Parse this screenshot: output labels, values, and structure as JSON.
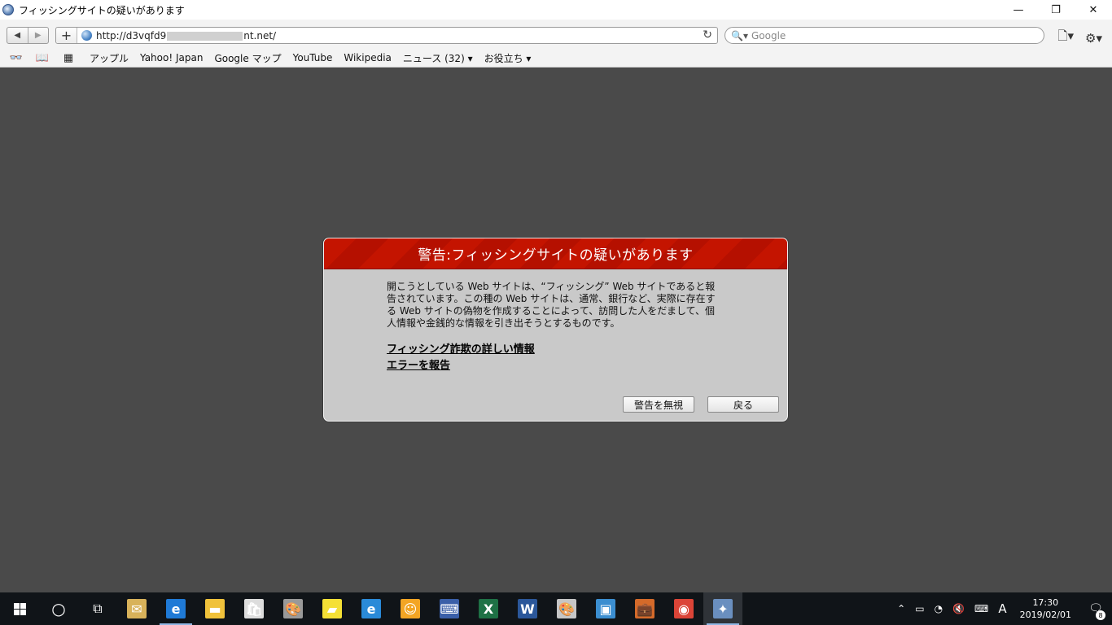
{
  "window": {
    "title": "フィッシングサイトの疑いがあります",
    "minimize_glyph": "—",
    "restore_glyph": "❐",
    "close_glyph": "✕"
  },
  "toolbar": {
    "back_glyph": "◀",
    "forward_glyph": "▶",
    "new_tab_glyph": "+",
    "url_prefix": "http://d3vqfd9",
    "url_suffix": "nt.net/",
    "reload_glyph": "↻",
    "search_placeholder": "Google",
    "search_icon_glyph": "🔍▾",
    "page_menu_glyph": "🗋▾",
    "settings_glyph": "⚙▾"
  },
  "bookmarks": {
    "reader_icon": "👓",
    "book_icon": "📖",
    "grid_icon": "▦",
    "items": [
      "アップル",
      "Yahoo! Japan",
      "Google マップ",
      "YouTube",
      "Wikipedia",
      "ニュース (32) ▾",
      "お役立ち ▾"
    ]
  },
  "dialog": {
    "title": "警告:フィッシングサイトの疑いがあります",
    "body": "開こうとしている Web サイトは、“フィッシング” Web サイトであると報告されています。この種の Web サイトは、通常、銀行など、実際に存在する Web サイトの偽物を作成することによって、訪問した人をだまして、個人情報や金銭的な情報を引き出そうとするものです。",
    "link_info": "フィッシング詐欺の詳しい情報",
    "link_report": "エラーを報告",
    "ignore_button": "警告を無視",
    "back_button": "戻る"
  },
  "taskbar": {
    "search_glyph": "○",
    "task_view_glyph": "⧉",
    "icons": [
      {
        "name": "mail-app-icon",
        "glyph": "✉",
        "color": "#d8b25a"
      },
      {
        "name": "edge-icon",
        "glyph": "e",
        "color": "#1f7ad6"
      },
      {
        "name": "file-explorer-icon",
        "glyph": "▬",
        "color": "#f0c23b"
      },
      {
        "name": "store-icon",
        "glyph": "🛍",
        "color": "#dddddd"
      },
      {
        "name": "paint-icon",
        "glyph": "🎨",
        "color": "#999999"
      },
      {
        "name": "sticky-notes-icon",
        "glyph": "▰",
        "color": "#f5e035"
      },
      {
        "name": "internet-explorer-icon",
        "glyph": "e",
        "color": "#2a8ad8"
      },
      {
        "name": "app-orange-icon",
        "glyph": "☺",
        "color": "#f3a524"
      },
      {
        "name": "app-keyboard-icon",
        "glyph": "⌨",
        "color": "#3a5fa8"
      },
      {
        "name": "excel-icon",
        "glyph": "X",
        "color": "#1e7145"
      },
      {
        "name": "word-icon",
        "glyph": "W",
        "color": "#2b579a"
      },
      {
        "name": "paint-palette-icon",
        "glyph": "🎨",
        "color": "#c6c6c6"
      },
      {
        "name": "app-blue-icon",
        "glyph": "▣",
        "color": "#3b8ed0"
      },
      {
        "name": "briefcase-icon",
        "glyph": "💼",
        "color": "#d46a2a"
      },
      {
        "name": "chrome-icon",
        "glyph": "◉",
        "color": "#db4437"
      },
      {
        "name": "safari-icon",
        "glyph": "✦",
        "color": "#6a8fbf"
      }
    ],
    "tray_up_glyph": "⌃",
    "battery_glyph": "▭",
    "wifi_glyph": "◔",
    "volume_glyph": "🔇",
    "keyboard_glyph": "⌨",
    "ime": "A",
    "time": "17:30",
    "date": "2019/02/01",
    "notification_glyph": "🗨",
    "notification_count": "8"
  }
}
